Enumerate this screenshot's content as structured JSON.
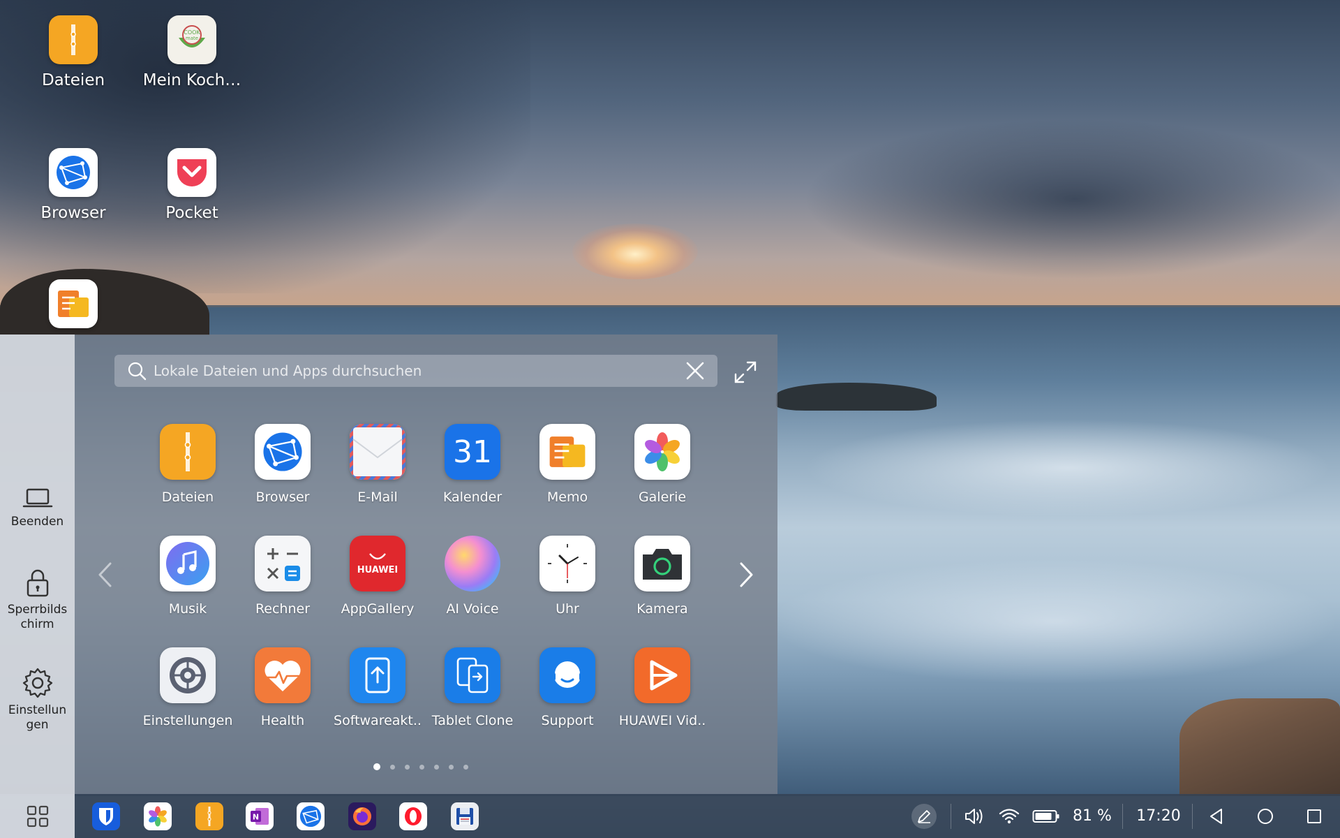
{
  "desktop": {
    "icons": [
      {
        "label": "Dateien",
        "icon": "files-icon"
      },
      {
        "label": "Mein Koch…",
        "icon": "cookbook-icon"
      },
      {
        "label": "Browser",
        "icon": "browser-icon"
      },
      {
        "label": "Pocket",
        "icon": "pocket-icon"
      },
      {
        "label": "",
        "icon": "memo-icon"
      }
    ]
  },
  "start_menu": {
    "search": {
      "placeholder": "Lokale Dateien und Apps durchsuchen"
    },
    "side": {
      "exit_label": "Beenden",
      "lock_label": "Sperrbilds chirm",
      "settings_label": "Einstellun gen"
    },
    "apps": [
      {
        "label": "Dateien",
        "icon": "files-icon"
      },
      {
        "label": "Browser",
        "icon": "browser-icon"
      },
      {
        "label": "E-Mail",
        "icon": "email-icon"
      },
      {
        "label": "Kalender",
        "icon": "calendar-icon",
        "text": "31"
      },
      {
        "label": "Memo",
        "icon": "memo-icon"
      },
      {
        "label": "Galerie",
        "icon": "gallery-icon"
      },
      {
        "label": "Musik",
        "icon": "music-icon"
      },
      {
        "label": "Rechner",
        "icon": "calculator-icon"
      },
      {
        "label": "AppGallery",
        "icon": "appgallery-icon",
        "text": "HUAWEI"
      },
      {
        "label": "AI Voice",
        "icon": "ai-voice-icon"
      },
      {
        "label": "Uhr",
        "icon": "clock-icon"
      },
      {
        "label": "Kamera",
        "icon": "camera-icon"
      },
      {
        "label": "Einstellungen",
        "icon": "settings-icon"
      },
      {
        "label": "Health",
        "icon": "health-icon"
      },
      {
        "label": "Softwareakt..",
        "icon": "software-update-icon"
      },
      {
        "label": "Tablet Clone",
        "icon": "tablet-clone-icon"
      },
      {
        "label": "Support",
        "icon": "support-icon"
      },
      {
        "label": "HUAWEI Vid..",
        "icon": "video-icon"
      }
    ],
    "pages": {
      "count": 7,
      "current": 1
    }
  },
  "taskbar": {
    "apps": [
      "bitwarden-icon",
      "gallery-icon",
      "files-icon",
      "onenote-icon",
      "browser-icon",
      "firefox-icon",
      "opera-icon",
      "floppy-save-icon"
    ],
    "battery_percent": "81 %",
    "time": "17:20"
  },
  "colors": {
    "accent_blue": "#1a73e8",
    "files_orange": "#f5a623",
    "huawei_red": "#e0282d"
  }
}
